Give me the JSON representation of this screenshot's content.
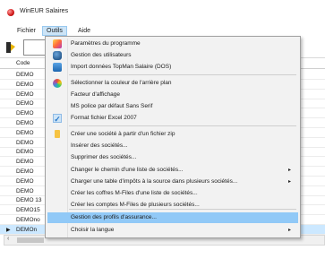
{
  "window": {
    "title": "WinEUR Salaires"
  },
  "menubar": {
    "items": [
      "Fichier",
      "Outils",
      "Aide"
    ]
  },
  "grid": {
    "header": "Code",
    "rows": [
      "DEMO",
      "DEMO",
      "DEMO",
      "DEMO",
      "DEMO",
      "DEMO",
      "DEMO",
      "DEMO",
      "DEMO",
      "DEMO",
      "DEMO",
      "DEMO",
      "DEMO",
      "DEMO 13",
      "DEMO15",
      "DEMOno",
      "DEMOn"
    ],
    "selected_row_index": 16
  },
  "dropdown": {
    "items": [
      {
        "label": "Paramètres du programme",
        "icon": "settings-icon"
      },
      {
        "label": "Gestion des utilisateurs",
        "icon": "users-icon"
      },
      {
        "label": "Import données TopMan Salaire (DOS)",
        "icon": "import-icon"
      },
      {
        "label": "Sélectionner la couleur de l'arrière plan",
        "icon": "palette-icon"
      },
      {
        "label": "Facteur d'affichage"
      },
      {
        "label": "MS police par défaut Sans Serif"
      },
      {
        "label": "Format fichier Excel 2007",
        "checked": true
      },
      {
        "label": "Créer une société à partir d'un fichier zip",
        "icon": "zip-icon"
      },
      {
        "label": "Insérer des sociétés..."
      },
      {
        "label": "Supprimer des sociétés..."
      },
      {
        "label": "Changer le chemin d'une liste de sociétés...",
        "submenu": true
      },
      {
        "label": "Charger une table d'impôts à la source dans plusieurs sociétés...",
        "submenu": true
      },
      {
        "label": "Créer les coffres M-Files d'une liste de sociétés..."
      },
      {
        "label": "Créer les comptes M-Files de plusieurs sociétés..."
      },
      {
        "label": "Gestion des profils d'assurance...",
        "highlighted": true
      },
      {
        "label": "Choisir la langue",
        "submenu": true
      }
    ]
  },
  "colors": {
    "menu_highlight": "#91c9f7",
    "selected_row": "#cce8ff"
  }
}
